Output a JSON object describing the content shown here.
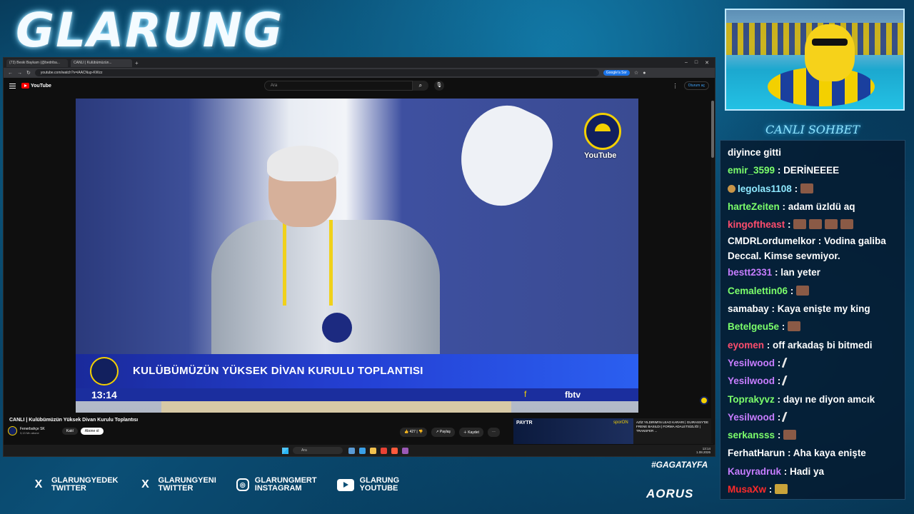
{
  "overlay": {
    "channel_title": "GLARUNG",
    "chat_header": "CANLI SOHBET",
    "hashtag": "#GAGATAYFA",
    "brand": "AORUS",
    "socials": [
      {
        "icon": "x-twitter-icon",
        "line1": "GLARUNGYEDEK",
        "line2": "TWITTER"
      },
      {
        "icon": "x-twitter-icon",
        "line1": "GLARUNGYENI",
        "line2": "TWITTER"
      },
      {
        "icon": "instagram-icon",
        "line1": "GLARUNGMERT",
        "line2": "INSTAGRAM"
      },
      {
        "icon": "youtube-icon",
        "line1": "GLARUNG",
        "line2": "YOUTUBE"
      }
    ]
  },
  "browser": {
    "tabs": [
      "(73) Beski Baykam (@bedriba...",
      "CANLI | Kulübümüzün..."
    ],
    "url": "youtube.com/watch?v=iAACNup-KWzz",
    "google_pill": "Google'a Sor"
  },
  "youtube": {
    "logo": "YouTube",
    "search_placeholder": "Ara",
    "signin": "Oturum aç",
    "video": {
      "watermark": "YouTube",
      "lower_third_title": "KULÜBÜMÜZÜN YÜKSEK DİVAN KURULU TOPLANTISI",
      "time": "13:14",
      "network": "fbtv"
    },
    "title": "CANLI | Kulübümüzün Yüksek Divan Kurulu Toplantısı",
    "channel": "Fenerbahçe SK",
    "subscribers": "3,13 Mn abone",
    "join": "Katıl",
    "subscribe": "Abone ol",
    "likes": "427",
    "share": "Paylaş",
    "save": "Kaydet",
    "ad": {
      "brand": "PAYTR",
      "sport": "sporON",
      "text": "AZİZ YILDIRIM'IN LEAO KARARI | GUIRASSY'DE FRENE BASILDI | FORMA ADALETSİZLİĞİ | TRANSFER ..."
    }
  },
  "taskbar": {
    "search": "Ara",
    "time": "13:14",
    "date": "1.08.2026"
  },
  "chat": [
    {
      "user": "",
      "color": "#ffffff",
      "text": "diyince gitti"
    },
    {
      "user": "emir_3599",
      "color": "#7cff6b",
      "text": "DERİNEEEE"
    },
    {
      "user": "legolas1108",
      "color": "#8fe9ff",
      "text": "",
      "emotes": 1,
      "avatar": true
    },
    {
      "user": "harteZeiten",
      "color": "#7cff6b",
      "text": "adam üzldü aq"
    },
    {
      "user": "kingoftheast",
      "color": "#ff4d6d",
      "text": "",
      "emotes": 4
    },
    {
      "user": "CMDRLordumelkor",
      "color": "#ffffff",
      "text": "Vodina galiba Deccal. Kimse sevmiyor.",
      "multi": true
    },
    {
      "user": "bestt2331",
      "color": "#c77dff",
      "text": "lan yeter"
    },
    {
      "user": "Cemalettin06",
      "color": "#7cff6b",
      "text": "",
      "emotes": 1
    },
    {
      "user": "samabay",
      "color": "#ffffff",
      "text": "Kaya enişte my king"
    },
    {
      "user": "Betelgeu5e",
      "color": "#7cff6b",
      "text": "",
      "emotes": 1
    },
    {
      "user": "eyomen",
      "color": "#ff4d6d",
      "text": "off arkadaş bi bitmedi"
    },
    {
      "user": "Yesilwood",
      "color": "#c77dff",
      "text": "",
      "feather": true
    },
    {
      "user": "Yesilwood",
      "color": "#c77dff",
      "text": "",
      "feather": true
    },
    {
      "user": "Toprakyvz",
      "color": "#7cff6b",
      "text": "dayı ne diyon amcık"
    },
    {
      "user": "Yesilwood",
      "color": "#c77dff",
      "text": "",
      "feather": true
    },
    {
      "user": "serkansss",
      "color": "#7cff6b",
      "text": "",
      "emotes": 1
    },
    {
      "user": "FerhatHarun",
      "color": "#ffffff",
      "text": "Aha kaya enişte"
    },
    {
      "user": "Kauyradruk",
      "color": "#c77dff",
      "text": "Hadi ya"
    },
    {
      "user": "MusaXw",
      "color": "#ff2a2a",
      "text": "",
      "gold": true
    }
  ]
}
